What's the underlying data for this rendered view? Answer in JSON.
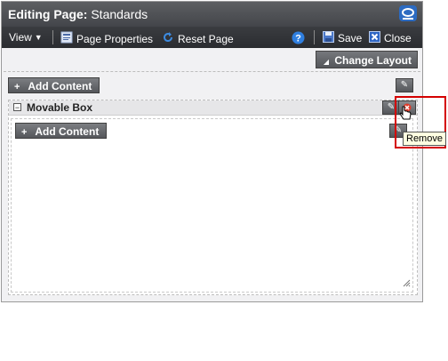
{
  "titlebar": {
    "prefix": "Editing Page:",
    "page_name": "Standards"
  },
  "toolbar": {
    "view_label": "View",
    "page_properties_label": "Page Properties",
    "reset_page_label": "Reset Page",
    "save_label": "Save",
    "close_label": "Close"
  },
  "layout": {
    "change_layout_label": "Change Layout"
  },
  "top_region": {
    "add_content_label": "Add Content"
  },
  "movable_box": {
    "title": "Movable Box",
    "add_content_label": "Add Content"
  },
  "tooltip": {
    "text": "Remove"
  },
  "colors": {
    "highlight": "#d40000",
    "toolbar": "#2a2c30",
    "brand": "#2c6bc2"
  }
}
